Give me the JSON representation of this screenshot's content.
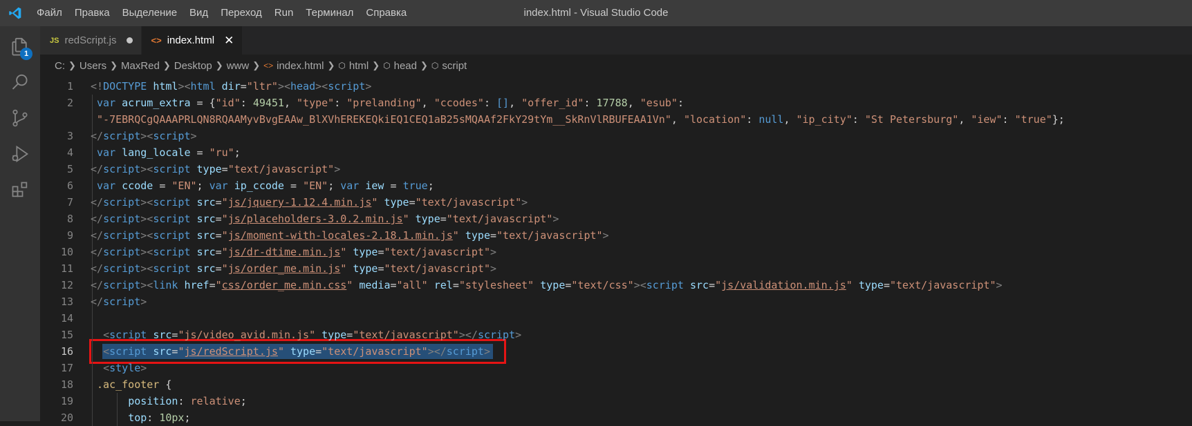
{
  "window": {
    "title": "index.html - Visual Studio Code"
  },
  "menu": {
    "items": [
      "Файл",
      "Правка",
      "Выделение",
      "Вид",
      "Переход",
      "Run",
      "Терминал",
      "Справка"
    ]
  },
  "activity": {
    "explorer_badge": "1"
  },
  "tabs": [
    {
      "icon": "JS",
      "label": "redScript.js"
    },
    {
      "icon": "<>",
      "label": "index.html"
    }
  ],
  "breadcrumbs": {
    "path": [
      "C:",
      "Users",
      "MaxRed",
      "Desktop",
      "www"
    ],
    "file": "index.html",
    "symbols": [
      "html",
      "head",
      "script"
    ]
  },
  "editor": {
    "lines": [
      {
        "n": "1",
        "indent": 0,
        "tokens": [
          [
            "punc",
            "<!"
          ],
          [
            "tag",
            "DOCTYPE"
          ],
          [
            "text",
            " "
          ],
          [
            "attr",
            "html"
          ],
          [
            "punc",
            ">"
          ],
          [
            "punc",
            "<"
          ],
          [
            "tag",
            "html"
          ],
          [
            "text",
            " "
          ],
          [
            "attr",
            "dir"
          ],
          [
            "text",
            "="
          ],
          [
            "str",
            "\"ltr\""
          ],
          [
            "punc",
            ">"
          ],
          [
            "punc",
            "<"
          ],
          [
            "tag",
            "head"
          ],
          [
            "punc",
            ">"
          ],
          [
            "punc",
            "<"
          ],
          [
            "tag",
            "script"
          ],
          [
            "punc",
            ">"
          ]
        ]
      },
      {
        "n": "2",
        "indent": 1,
        "tokens": [
          [
            "text",
            " "
          ],
          [
            "key",
            "var"
          ],
          [
            "text",
            " "
          ],
          [
            "var",
            "acrum_extra"
          ],
          [
            "text",
            " = {"
          ],
          [
            "str",
            "\"id\""
          ],
          [
            "text",
            ": "
          ],
          [
            "num",
            "49451"
          ],
          [
            "text",
            ", "
          ],
          [
            "str",
            "\"type\""
          ],
          [
            "text",
            ": "
          ],
          [
            "str",
            "\"prelanding\""
          ],
          [
            "text",
            ", "
          ],
          [
            "str",
            "\"ccodes\""
          ],
          [
            "text",
            ": "
          ],
          [
            "key",
            "[]"
          ],
          [
            "text",
            ", "
          ],
          [
            "str",
            "\"offer_id\""
          ],
          [
            "text",
            ": "
          ],
          [
            "num",
            "17788"
          ],
          [
            "text",
            ", "
          ],
          [
            "str",
            "\"esub\""
          ],
          [
            "text",
            ":"
          ]
        ]
      },
      {
        "n": "",
        "indent": 1,
        "tokens": [
          [
            "text",
            " "
          ],
          [
            "str",
            "\"-7EBRQCgQAAAPRLQN8RQAAMyvBvgEAAw_BlXVhEREKEQkiEQ1CEQ1aB25sMQAAf2FkY29tYm__SkRnVlRBUFEAA1Vn\""
          ],
          [
            "text",
            ", "
          ],
          [
            "str",
            "\"location\""
          ],
          [
            "text",
            ": "
          ],
          [
            "key",
            "null"
          ],
          [
            "text",
            ", "
          ],
          [
            "str",
            "\"ip_city\""
          ],
          [
            "text",
            ": "
          ],
          [
            "str",
            "\"St Petersburg\""
          ],
          [
            "text",
            ", "
          ],
          [
            "str",
            "\"iew\""
          ],
          [
            "text",
            ": "
          ],
          [
            "str",
            "\"true\""
          ],
          [
            "text",
            "};"
          ]
        ]
      },
      {
        "n": "3",
        "indent": 1,
        "tokens": [
          [
            "punc",
            "</"
          ],
          [
            "tag",
            "script"
          ],
          [
            "punc",
            ">"
          ],
          [
            "punc",
            "<"
          ],
          [
            "tag",
            "script"
          ],
          [
            "punc",
            ">"
          ]
        ]
      },
      {
        "n": "4",
        "indent": 1,
        "tokens": [
          [
            "text",
            " "
          ],
          [
            "key",
            "var"
          ],
          [
            "text",
            " "
          ],
          [
            "var",
            "lang_locale"
          ],
          [
            "text",
            " = "
          ],
          [
            "str",
            "\"ru\""
          ],
          [
            "text",
            ";"
          ]
        ]
      },
      {
        "n": "5",
        "indent": 1,
        "tokens": [
          [
            "punc",
            "</"
          ],
          [
            "tag",
            "script"
          ],
          [
            "punc",
            ">"
          ],
          [
            "punc",
            "<"
          ],
          [
            "tag",
            "script"
          ],
          [
            "text",
            " "
          ],
          [
            "attr",
            "type"
          ],
          [
            "text",
            "="
          ],
          [
            "str",
            "\"text/javascript\""
          ],
          [
            "punc",
            ">"
          ]
        ]
      },
      {
        "n": "6",
        "indent": 1,
        "tokens": [
          [
            "text",
            " "
          ],
          [
            "key",
            "var"
          ],
          [
            "text",
            " "
          ],
          [
            "var",
            "ccode"
          ],
          [
            "text",
            " = "
          ],
          [
            "str",
            "\"EN\""
          ],
          [
            "text",
            "; "
          ],
          [
            "key",
            "var"
          ],
          [
            "text",
            " "
          ],
          [
            "var",
            "ip_ccode"
          ],
          [
            "text",
            " = "
          ],
          [
            "str",
            "\"EN\""
          ],
          [
            "text",
            "; "
          ],
          [
            "key",
            "var"
          ],
          [
            "text",
            " "
          ],
          [
            "var",
            "iew"
          ],
          [
            "text",
            " = "
          ],
          [
            "key",
            "true"
          ],
          [
            "text",
            ";"
          ]
        ]
      },
      {
        "n": "7",
        "indent": 1,
        "tokens": [
          [
            "punc",
            "</"
          ],
          [
            "tag",
            "script"
          ],
          [
            "punc",
            ">"
          ],
          [
            "punc",
            "<"
          ],
          [
            "tag",
            "script"
          ],
          [
            "text",
            " "
          ],
          [
            "attr",
            "src"
          ],
          [
            "text",
            "="
          ],
          [
            "str",
            "\""
          ],
          [
            "strul",
            "js/jquery-1.12.4.min.js"
          ],
          [
            "str",
            "\""
          ],
          [
            "text",
            " "
          ],
          [
            "attr",
            "type"
          ],
          [
            "text",
            "="
          ],
          [
            "str",
            "\"text/javascript\""
          ],
          [
            "punc",
            ">"
          ]
        ]
      },
      {
        "n": "8",
        "indent": 1,
        "tokens": [
          [
            "punc",
            "</"
          ],
          [
            "tag",
            "script"
          ],
          [
            "punc",
            ">"
          ],
          [
            "punc",
            "<"
          ],
          [
            "tag",
            "script"
          ],
          [
            "text",
            " "
          ],
          [
            "attr",
            "src"
          ],
          [
            "text",
            "="
          ],
          [
            "str",
            "\""
          ],
          [
            "strul",
            "js/placeholders-3.0.2.min.js"
          ],
          [
            "str",
            "\""
          ],
          [
            "text",
            " "
          ],
          [
            "attr",
            "type"
          ],
          [
            "text",
            "="
          ],
          [
            "str",
            "\"text/javascript\""
          ],
          [
            "punc",
            ">"
          ]
        ]
      },
      {
        "n": "9",
        "indent": 1,
        "tokens": [
          [
            "punc",
            "</"
          ],
          [
            "tag",
            "script"
          ],
          [
            "punc",
            ">"
          ],
          [
            "punc",
            "<"
          ],
          [
            "tag",
            "script"
          ],
          [
            "text",
            " "
          ],
          [
            "attr",
            "src"
          ],
          [
            "text",
            "="
          ],
          [
            "str",
            "\""
          ],
          [
            "strul",
            "js/moment-with-locales-2.18.1.min.js"
          ],
          [
            "str",
            "\""
          ],
          [
            "text",
            " "
          ],
          [
            "attr",
            "type"
          ],
          [
            "text",
            "="
          ],
          [
            "str",
            "\"text/javascript\""
          ],
          [
            "punc",
            ">"
          ]
        ]
      },
      {
        "n": "10",
        "indent": 1,
        "tokens": [
          [
            "punc",
            "</"
          ],
          [
            "tag",
            "script"
          ],
          [
            "punc",
            ">"
          ],
          [
            "punc",
            "<"
          ],
          [
            "tag",
            "script"
          ],
          [
            "text",
            " "
          ],
          [
            "attr",
            "src"
          ],
          [
            "text",
            "="
          ],
          [
            "str",
            "\""
          ],
          [
            "strul",
            "js/dr-dtime.min.js"
          ],
          [
            "str",
            "\""
          ],
          [
            "text",
            " "
          ],
          [
            "attr",
            "type"
          ],
          [
            "text",
            "="
          ],
          [
            "str",
            "\"text/javascript\""
          ],
          [
            "punc",
            ">"
          ]
        ]
      },
      {
        "n": "11",
        "indent": 1,
        "tokens": [
          [
            "punc",
            "</"
          ],
          [
            "tag",
            "script"
          ],
          [
            "punc",
            ">"
          ],
          [
            "punc",
            "<"
          ],
          [
            "tag",
            "script"
          ],
          [
            "text",
            " "
          ],
          [
            "attr",
            "src"
          ],
          [
            "text",
            "="
          ],
          [
            "str",
            "\""
          ],
          [
            "strul",
            "js/order_me.min.js"
          ],
          [
            "str",
            "\""
          ],
          [
            "text",
            " "
          ],
          [
            "attr",
            "type"
          ],
          [
            "text",
            "="
          ],
          [
            "str",
            "\"text/javascript\""
          ],
          [
            "punc",
            ">"
          ]
        ]
      },
      {
        "n": "12",
        "indent": 1,
        "tokens": [
          [
            "punc",
            "</"
          ],
          [
            "tag",
            "script"
          ],
          [
            "punc",
            ">"
          ],
          [
            "punc",
            "<"
          ],
          [
            "tag",
            "link"
          ],
          [
            "text",
            " "
          ],
          [
            "attr",
            "href"
          ],
          [
            "text",
            "="
          ],
          [
            "str",
            "\""
          ],
          [
            "strul",
            "css/order_me.min.css"
          ],
          [
            "str",
            "\""
          ],
          [
            "text",
            " "
          ],
          [
            "attr",
            "media"
          ],
          [
            "text",
            "="
          ],
          [
            "str",
            "\"all\""
          ],
          [
            "text",
            " "
          ],
          [
            "attr",
            "rel"
          ],
          [
            "text",
            "="
          ],
          [
            "str",
            "\"stylesheet\""
          ],
          [
            "text",
            " "
          ],
          [
            "attr",
            "type"
          ],
          [
            "text",
            "="
          ],
          [
            "str",
            "\"text/css\""
          ],
          [
            "punc",
            ">"
          ],
          [
            "punc",
            "<"
          ],
          [
            "tag",
            "script"
          ],
          [
            "text",
            " "
          ],
          [
            "attr",
            "src"
          ],
          [
            "text",
            "="
          ],
          [
            "str",
            "\""
          ],
          [
            "strul",
            "js/validation.min.js"
          ],
          [
            "str",
            "\""
          ],
          [
            "text",
            " "
          ],
          [
            "attr",
            "type"
          ],
          [
            "text",
            "="
          ],
          [
            "str",
            "\"text/javascript\""
          ],
          [
            "punc",
            ">"
          ]
        ]
      },
      {
        "n": "13",
        "indent": 1,
        "tokens": [
          [
            "punc",
            "</"
          ],
          [
            "tag",
            "script"
          ],
          [
            "punc",
            ">"
          ]
        ]
      },
      {
        "n": "14",
        "indent": 1,
        "tokens": []
      },
      {
        "n": "15",
        "indent": 1,
        "tokens": [
          [
            "text",
            "  "
          ],
          [
            "punc",
            "<"
          ],
          [
            "tag",
            "script"
          ],
          [
            "text",
            " "
          ],
          [
            "attr",
            "src"
          ],
          [
            "text",
            "="
          ],
          [
            "str",
            "\"js/video_avid.min.js\""
          ],
          [
            "text",
            " "
          ],
          [
            "attr",
            "type"
          ],
          [
            "text",
            "="
          ],
          [
            "str",
            "\"text/javascript\""
          ],
          [
            "punc",
            "></"
          ],
          [
            "tag",
            "script"
          ],
          [
            "punc",
            ">"
          ]
        ]
      },
      {
        "n": "16",
        "indent": 1,
        "current": true,
        "tokens": [
          [
            "text",
            "  "
          ],
          [
            "punc",
            "<"
          ],
          [
            "tag",
            "script"
          ],
          [
            "text",
            " "
          ],
          [
            "attr",
            "src"
          ],
          [
            "text",
            "="
          ],
          [
            "str",
            "\""
          ],
          [
            "strul",
            "js/redScript.js"
          ],
          [
            "str",
            "\""
          ],
          [
            "text",
            " "
          ],
          [
            "attr",
            "type"
          ],
          [
            "text",
            "="
          ],
          [
            "str",
            "\"text/javascript\""
          ],
          [
            "punc",
            "></"
          ],
          [
            "tag",
            "script"
          ],
          [
            "punc",
            ">"
          ]
        ]
      },
      {
        "n": "17",
        "indent": 1,
        "tokens": [
          [
            "text",
            "  "
          ],
          [
            "punc",
            "<"
          ],
          [
            "tag",
            "style"
          ],
          [
            "punc",
            ">"
          ]
        ]
      },
      {
        "n": "18",
        "indent": 1,
        "tokens": [
          [
            "text",
            " "
          ],
          [
            "sel",
            ".ac_footer"
          ],
          [
            "text",
            " {"
          ]
        ]
      },
      {
        "n": "19",
        "indent": 2,
        "tokens": [
          [
            "text",
            "      "
          ],
          [
            "prop",
            "position"
          ],
          [
            "text",
            ": "
          ],
          [
            "str",
            "relative"
          ],
          [
            "text",
            ";"
          ]
        ]
      },
      {
        "n": "20",
        "indent": 2,
        "tokens": [
          [
            "text",
            "      "
          ],
          [
            "prop",
            "top"
          ],
          [
            "text",
            ": "
          ],
          [
            "num",
            "10px"
          ],
          [
            "text",
            ";"
          ]
        ]
      }
    ]
  }
}
